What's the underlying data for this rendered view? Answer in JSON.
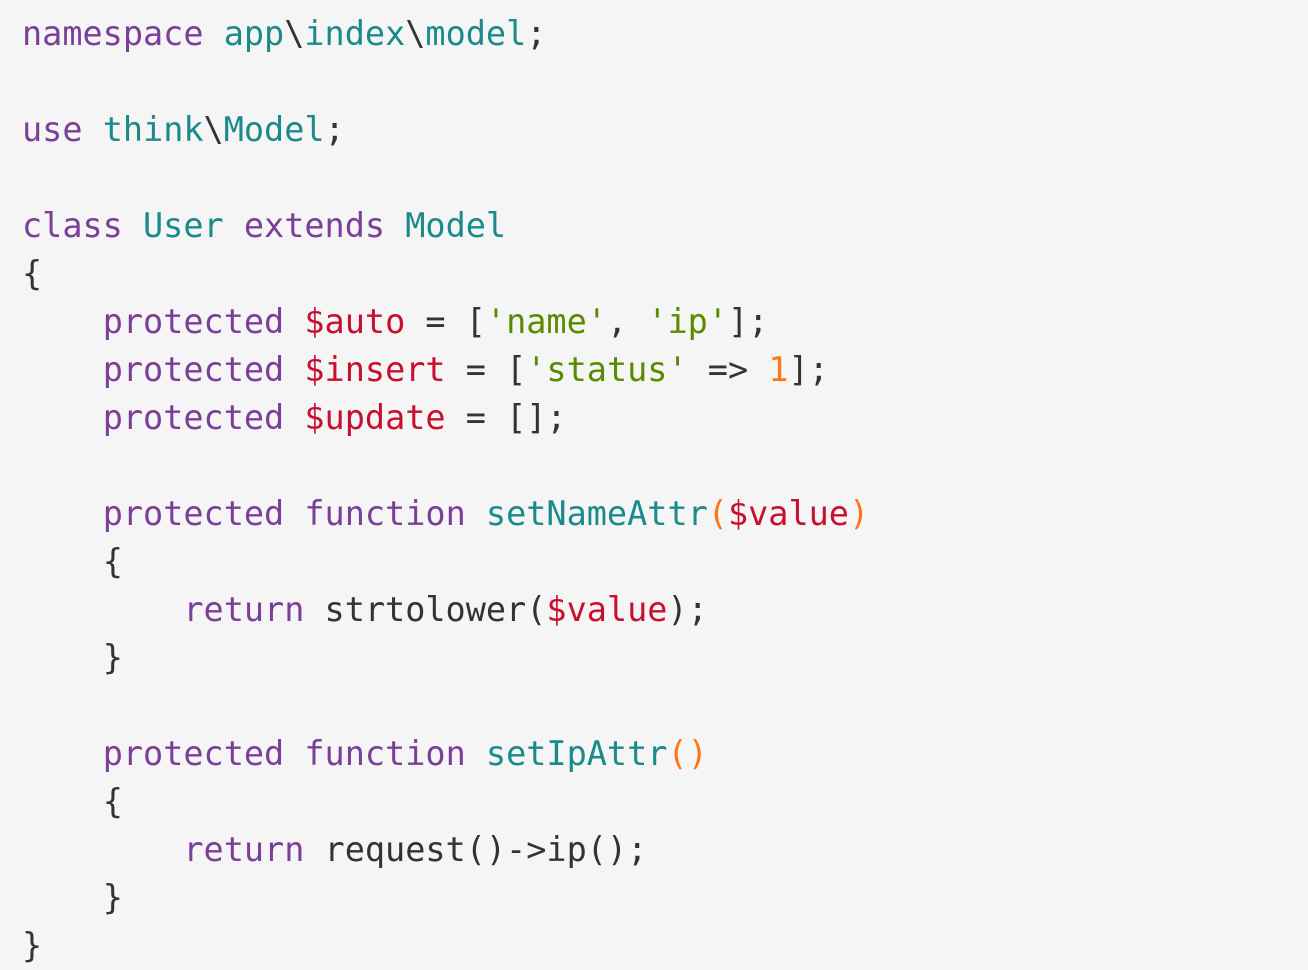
{
  "colors": {
    "background": "#f5f5f5",
    "keyword": "#7b3f9a",
    "type": "#1a8a8a",
    "variable": "#c8102e",
    "string": "#5a8a00",
    "number": "#ff7518",
    "paren": "#ff7518",
    "punctuation": "#333333"
  },
  "lines": [
    [
      {
        "t": "namespace",
        "k": "kw"
      },
      {
        "t": " ",
        "k": "plain"
      },
      {
        "t": "app",
        "k": "type"
      },
      {
        "t": "\\",
        "k": "pun"
      },
      {
        "t": "index",
        "k": "type"
      },
      {
        "t": "\\",
        "k": "pun"
      },
      {
        "t": "model",
        "k": "type"
      },
      {
        "t": ";",
        "k": "pun"
      }
    ],
    [],
    [
      {
        "t": "use",
        "k": "kw"
      },
      {
        "t": " ",
        "k": "plain"
      },
      {
        "t": "think",
        "k": "type"
      },
      {
        "t": "\\",
        "k": "pun"
      },
      {
        "t": "Model",
        "k": "type"
      },
      {
        "t": ";",
        "k": "pun"
      }
    ],
    [],
    [
      {
        "t": "class",
        "k": "kw"
      },
      {
        "t": " ",
        "k": "plain"
      },
      {
        "t": "User",
        "k": "type"
      },
      {
        "t": " ",
        "k": "plain"
      },
      {
        "t": "extends",
        "k": "kw"
      },
      {
        "t": " ",
        "k": "plain"
      },
      {
        "t": "Model",
        "k": "type"
      }
    ],
    [
      {
        "t": "{",
        "k": "pun"
      }
    ],
    [
      {
        "t": "    ",
        "k": "plain"
      },
      {
        "t": "protected",
        "k": "kw"
      },
      {
        "t": " ",
        "k": "plain"
      },
      {
        "t": "$auto",
        "k": "var"
      },
      {
        "t": " = [",
        "k": "pun"
      },
      {
        "t": "'name'",
        "k": "str"
      },
      {
        "t": ", ",
        "k": "pun"
      },
      {
        "t": "'ip'",
        "k": "str"
      },
      {
        "t": "];",
        "k": "pun"
      }
    ],
    [
      {
        "t": "    ",
        "k": "plain"
      },
      {
        "t": "protected",
        "k": "kw"
      },
      {
        "t": " ",
        "k": "plain"
      },
      {
        "t": "$insert",
        "k": "var"
      },
      {
        "t": " = [",
        "k": "pun"
      },
      {
        "t": "'status'",
        "k": "str"
      },
      {
        "t": " => ",
        "k": "pun"
      },
      {
        "t": "1",
        "k": "num"
      },
      {
        "t": "];",
        "k": "pun"
      }
    ],
    [
      {
        "t": "    ",
        "k": "plain"
      },
      {
        "t": "protected",
        "k": "kw"
      },
      {
        "t": " ",
        "k": "plain"
      },
      {
        "t": "$update",
        "k": "var"
      },
      {
        "t": " = [];",
        "k": "pun"
      }
    ],
    [],
    [
      {
        "t": "    ",
        "k": "plain"
      },
      {
        "t": "protected",
        "k": "kw"
      },
      {
        "t": " ",
        "k": "plain"
      },
      {
        "t": "function",
        "k": "kw"
      },
      {
        "t": " ",
        "k": "plain"
      },
      {
        "t": "setNameAttr",
        "k": "type"
      },
      {
        "t": "(",
        "k": "par"
      },
      {
        "t": "$value",
        "k": "var"
      },
      {
        "t": ")",
        "k": "par"
      }
    ],
    [
      {
        "t": "    ",
        "k": "plain"
      },
      {
        "t": "{",
        "k": "pun"
      }
    ],
    [
      {
        "t": "        ",
        "k": "plain"
      },
      {
        "t": "return",
        "k": "kw"
      },
      {
        "t": " strtolower(",
        "k": "plain"
      },
      {
        "t": "$value",
        "k": "var"
      },
      {
        "t": ");",
        "k": "pun"
      }
    ],
    [
      {
        "t": "    ",
        "k": "plain"
      },
      {
        "t": "}",
        "k": "pun"
      }
    ],
    [],
    [
      {
        "t": "    ",
        "k": "plain"
      },
      {
        "t": "protected",
        "k": "kw"
      },
      {
        "t": " ",
        "k": "plain"
      },
      {
        "t": "function",
        "k": "kw"
      },
      {
        "t": " ",
        "k": "plain"
      },
      {
        "t": "setIpAttr",
        "k": "type"
      },
      {
        "t": "()",
        "k": "par"
      }
    ],
    [
      {
        "t": "    ",
        "k": "plain"
      },
      {
        "t": "{",
        "k": "pun"
      }
    ],
    [
      {
        "t": "        ",
        "k": "plain"
      },
      {
        "t": "return",
        "k": "kw"
      },
      {
        "t": " request()->ip();",
        "k": "plain"
      }
    ],
    [
      {
        "t": "    ",
        "k": "plain"
      },
      {
        "t": "}",
        "k": "pun"
      }
    ],
    [
      {
        "t": "}",
        "k": "pun"
      }
    ]
  ]
}
